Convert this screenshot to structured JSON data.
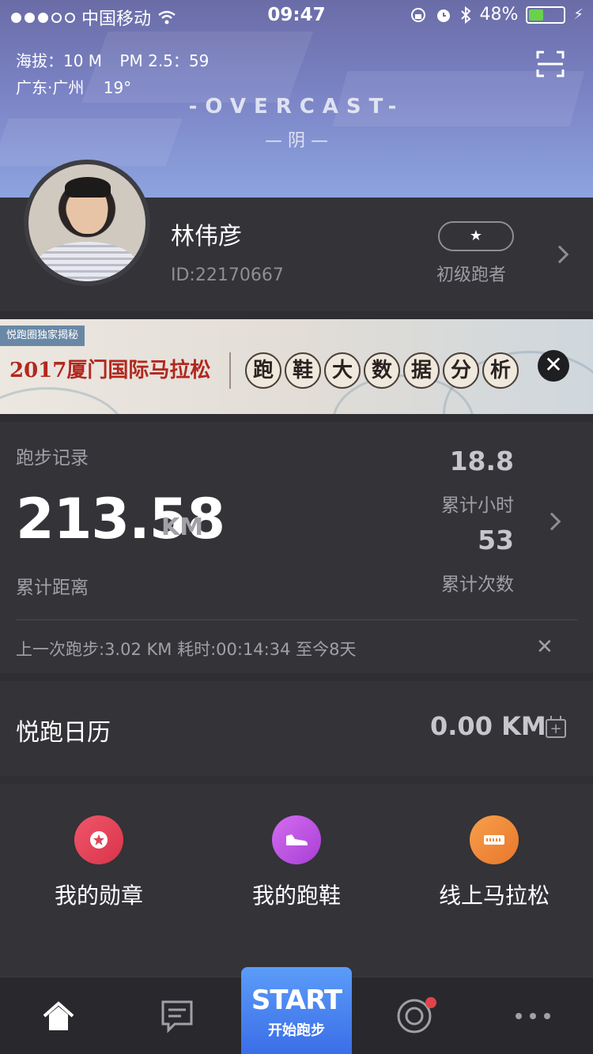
{
  "status_bar": {
    "carrier": "中国移动",
    "time": "09:47",
    "battery_percent": "48%",
    "battery_level": 0.48
  },
  "weather": {
    "altitude": "海拔：10 M",
    "pm": "PM 2.5：59",
    "location": "广东·广州",
    "temperature": "19°",
    "condition_en": "-OVERCAST-",
    "condition_cn": "— 阴 —"
  },
  "profile": {
    "name": "林伟彦",
    "id": "ID:22170667",
    "level_badge": "★",
    "level_name": "初级跑者"
  },
  "banner": {
    "tag": "悦跑圈独家揭秘",
    "title": "2017厦门国际马拉松",
    "chars": [
      "跑",
      "鞋",
      "大",
      "数",
      "据",
      "分",
      "析"
    ],
    "close": "✕"
  },
  "records": {
    "title": "跑步记录",
    "total_distance": "213.58",
    "unit": "KM",
    "total_distance_label": "累计距离",
    "hours": "18.8",
    "hours_label": "累计小时",
    "count": "53",
    "count_label": "累计次数",
    "last_run": "上一次跑步:3.02 KM 耗时:00:14:34 至今8天",
    "last_run_close": "✕"
  },
  "calendar": {
    "title": "悦跑日历",
    "value": "0.00 KM"
  },
  "menu": {
    "items": [
      {
        "label": "我的勋章",
        "icon": "medal-icon",
        "color": "#e8475a"
      },
      {
        "label": "我的跑鞋",
        "icon": "shoe-icon",
        "color": "#c24fe0"
      },
      {
        "label": "线上马拉松",
        "icon": "ticket-icon",
        "color": "#f08a3a"
      }
    ]
  },
  "tabbar": {
    "start_en": "START",
    "start_cn": "开始跑步",
    "tabs": [
      "home-icon",
      "message-icon",
      "start-button",
      "discover-icon",
      "more-icon"
    ]
  }
}
